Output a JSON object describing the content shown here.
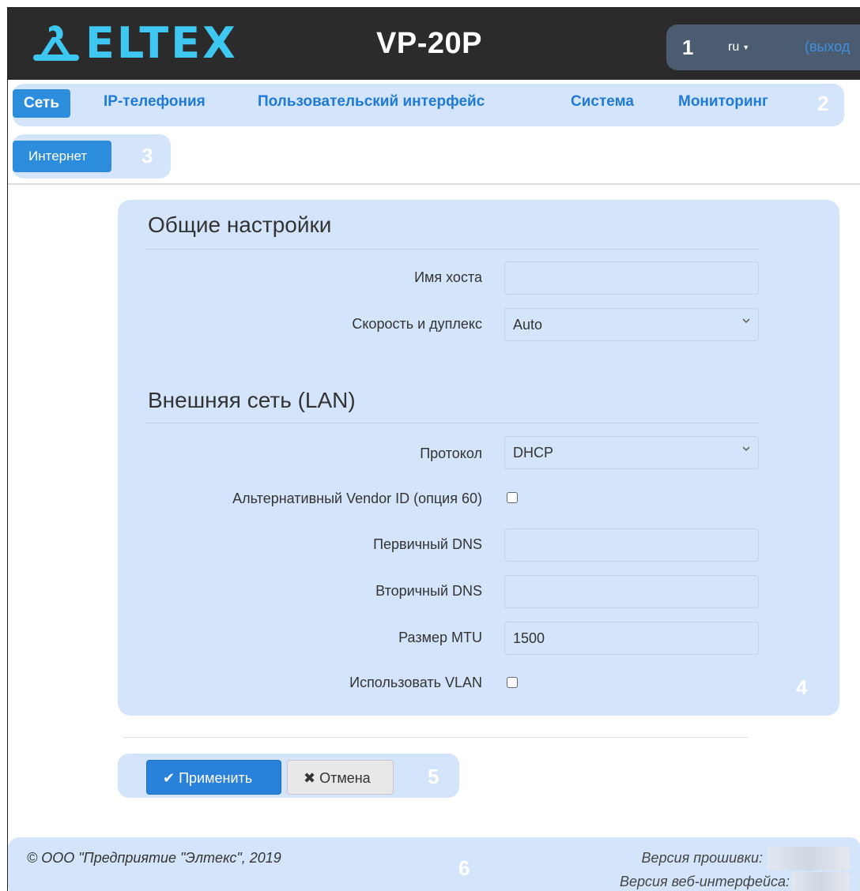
{
  "header": {
    "brand": "ELTEX",
    "model": "VP-20P",
    "tools_marker": "1",
    "language": "ru",
    "logout": "(выход"
  },
  "mainnav": {
    "marker": "2",
    "items": [
      {
        "label": "Сеть",
        "active": true
      },
      {
        "label": "IP-телефония",
        "active": false
      },
      {
        "label": "Пользовательский интерфейс",
        "active": false
      },
      {
        "label": "Система",
        "active": false
      },
      {
        "label": "Мониторинг",
        "active": false
      }
    ]
  },
  "subnav": {
    "marker": "3",
    "items": [
      {
        "label": "Интернет",
        "active": true
      }
    ]
  },
  "form": {
    "marker": "4",
    "general": {
      "title": "Общие настройки",
      "hostname_label": "Имя хоста",
      "hostname_value": "",
      "speed_label": "Скорость и дуплекс",
      "speed_value": "Auto"
    },
    "lan": {
      "title": "Внешняя сеть (LAN)",
      "protocol_label": "Протокол",
      "protocol_value": "DHCP",
      "vendor_label": "Альтернативный Vendor ID (опция 60)",
      "vendor_checked": false,
      "dns1_label": "Первичный DNS",
      "dns1_value": "",
      "dns2_label": "Вторичный DNS",
      "dns2_value": "",
      "mtu_label": "Размер MTU",
      "mtu_value": "1500",
      "vlan_label": "Использовать VLAN",
      "vlan_checked": false
    }
  },
  "actions": {
    "marker": "5",
    "apply": "Применить",
    "cancel": "Отмена"
  },
  "footer": {
    "marker": "6",
    "copyright": "© ООО \"Предприятие \"Элтекс\", 2019",
    "firmware_label": "Версия прошивки:",
    "web_label": "Версия веб-интерфейса:"
  },
  "colors": {
    "topbar": "#2b2b2b",
    "accent": "#2c8ddd",
    "panel": "#d4e5fb",
    "brand": "#3ec7f0"
  }
}
